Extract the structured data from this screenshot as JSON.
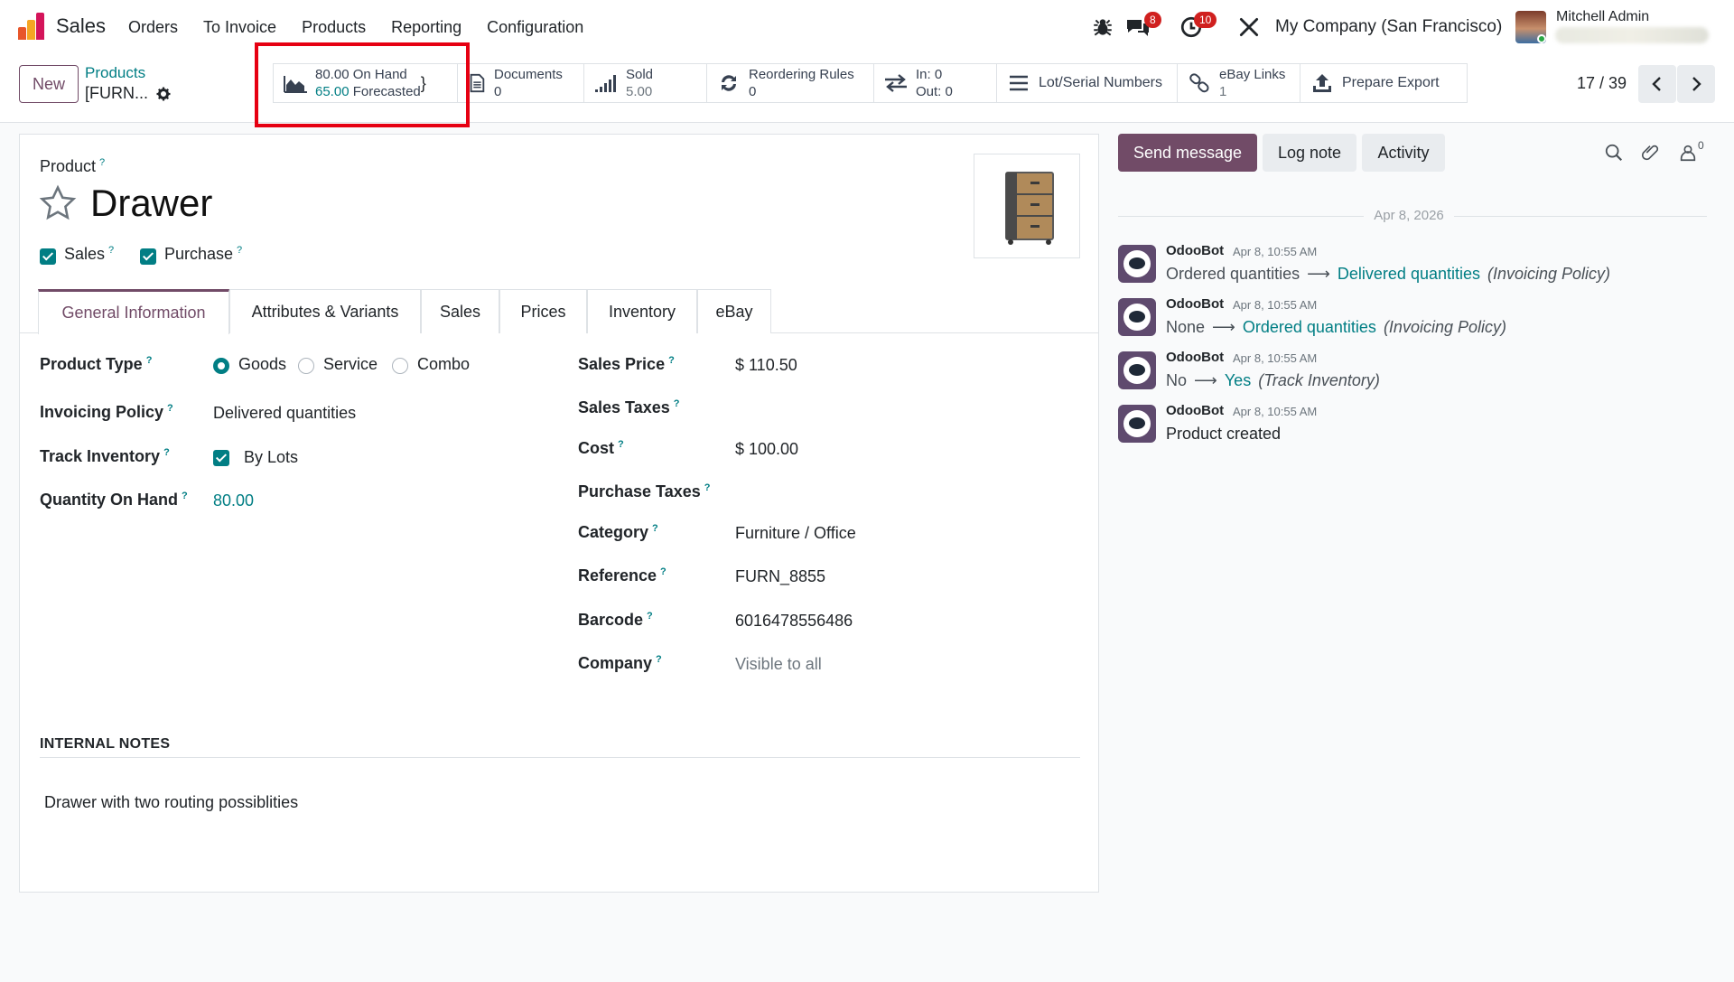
{
  "app": {
    "name": "Sales",
    "menu": [
      "Orders",
      "To Invoice",
      "Products",
      "Reporting",
      "Configuration"
    ],
    "brand_colors": {
      "primary": "#714b67",
      "link": "#017e84",
      "highlight": "#e60012"
    }
  },
  "systray": {
    "bug_icon": "bug-icon",
    "messages_badge": "8",
    "activities_badge": "10",
    "tools_icon": "tools-icon",
    "company": "My Company (San Francisco)",
    "user_name": "Mitchell Admin"
  },
  "control": {
    "new_label": "New",
    "breadcrumb_parent": "Products",
    "breadcrumb_current": "[FURN...",
    "pager": "17 / 39"
  },
  "stats": {
    "on_hand": {
      "value": "80.00",
      "label": "On Hand"
    },
    "forecasted": {
      "value": "65.00",
      "label": "Forecasted"
    },
    "documents": {
      "label": "Documents",
      "value": "0"
    },
    "sold": {
      "label": "Sold",
      "value": "5.00"
    },
    "reordering": {
      "label": "Reordering Rules",
      "value": "0"
    },
    "in_out": {
      "in": "In: 0",
      "out": "Out: 0"
    },
    "lots": {
      "label": "Lot/Serial Numbers"
    },
    "ebay": {
      "label": "eBay Links",
      "value": "1"
    },
    "export": {
      "label": "Prepare Export"
    }
  },
  "form": {
    "product_label": "Product",
    "name": "Drawer",
    "sales_label": "Sales",
    "purchase_label": "Purchase",
    "tabs": [
      "General Information",
      "Attributes & Variants",
      "Sales",
      "Prices",
      "Inventory",
      "eBay"
    ],
    "left_fields": {
      "product_type_label": "Product Type",
      "type_options": [
        "Goods",
        "Service",
        "Combo"
      ],
      "type_selected": "Goods",
      "invoicing_label": "Invoicing Policy",
      "invoicing_value": "Delivered quantities",
      "track_label": "Track Inventory",
      "track_value": "By Lots",
      "qty_label": "Quantity On Hand",
      "qty_value": "80.00"
    },
    "right_fields": {
      "sales_price_label": "Sales Price",
      "sales_price_value": "$ 110.50",
      "sales_taxes_label": "Sales Taxes",
      "cost_label": "Cost",
      "cost_value": "$ 100.00",
      "purchase_taxes_label": "Purchase Taxes",
      "category_label": "Category",
      "category_value": "Furniture / Office",
      "reference_label": "Reference",
      "reference_value": "FURN_8855",
      "barcode_label": "Barcode",
      "barcode_value": "6016478556486",
      "company_label": "Company",
      "company_value": "Visible to all"
    },
    "notes_header": "INTERNAL NOTES",
    "notes_text": "Drawer with two routing possiblities"
  },
  "chatter": {
    "send_message": "Send message",
    "log_note": "Log note",
    "activity": "Activity",
    "followers_count": "0",
    "date": "Apr 8, 2026",
    "messages": [
      {
        "author": "OdooBot",
        "time": "Apr 8, 10:55 AM",
        "old": "Ordered quantities",
        "new": "Delivered quantities",
        "field": "(Invoicing Policy)"
      },
      {
        "author": "OdooBot",
        "time": "Apr 8, 10:55 AM",
        "old": "None",
        "new": "Ordered quantities",
        "field": "(Invoicing Policy)"
      },
      {
        "author": "OdooBot",
        "time": "Apr 8, 10:55 AM",
        "old": "No",
        "new": "Yes",
        "field": "(Track Inventory)"
      },
      {
        "author": "OdooBot",
        "time": "Apr 8, 10:55 AM",
        "text": "Product created"
      }
    ]
  }
}
